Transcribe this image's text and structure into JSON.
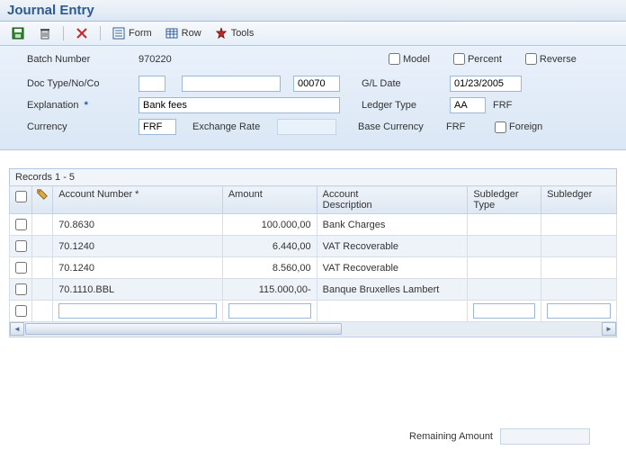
{
  "title": "Journal Entry",
  "toolbar": {
    "form_label": "Form",
    "row_label": "Row",
    "tools_label": "Tools"
  },
  "header": {
    "labels": {
      "batch_number": "Batch Number",
      "doc_type": "Doc Type/No/Co",
      "explanation": "Explanation",
      "currency": "Currency",
      "exchange_rate": "Exchange Rate",
      "gl_date": "G/L Date",
      "ledger_type": "Ledger Type",
      "base_currency": "Base Currency",
      "model": "Model",
      "percent": "Percent",
      "reverse": "Reverse",
      "foreign": "Foreign",
      "remaining_amount": "Remaining Amount"
    },
    "values": {
      "batch_number": "970220",
      "doc_type1": "",
      "doc_type2": "",
      "doc_type3": "00070",
      "explanation": "Bank fees",
      "currency": "FRF",
      "exchange_rate": "",
      "gl_date": "01/23/2005",
      "ledger_type": "AA",
      "ledger_curr": "FRF",
      "base_currency": "FRF",
      "remaining_amount": ""
    },
    "checks": {
      "model": false,
      "percent": false,
      "reverse": false,
      "foreign": false
    }
  },
  "grid": {
    "records_label": "Records 1 - 5",
    "columns": {
      "account_number": "Account Number *",
      "amount": "Amount",
      "account_description": "Account\nDescription",
      "subledger_type": "Subledger\nType",
      "subledger": "Subledger"
    },
    "rows": [
      {
        "account": "70.8630",
        "amount": "100.000,00",
        "desc": "Bank Charges",
        "subtype": "",
        "sub": ""
      },
      {
        "account": "70.1240",
        "amount": "6.440,00",
        "desc": "VAT Recoverable",
        "subtype": "",
        "sub": ""
      },
      {
        "account": "70.1240",
        "amount": "8.560,00",
        "desc": "VAT Recoverable",
        "subtype": "",
        "sub": ""
      },
      {
        "account": "70.1110.BBL",
        "amount": "115.000,00-",
        "desc": "Banque Bruxelles Lambert",
        "subtype": "",
        "sub": ""
      }
    ]
  }
}
